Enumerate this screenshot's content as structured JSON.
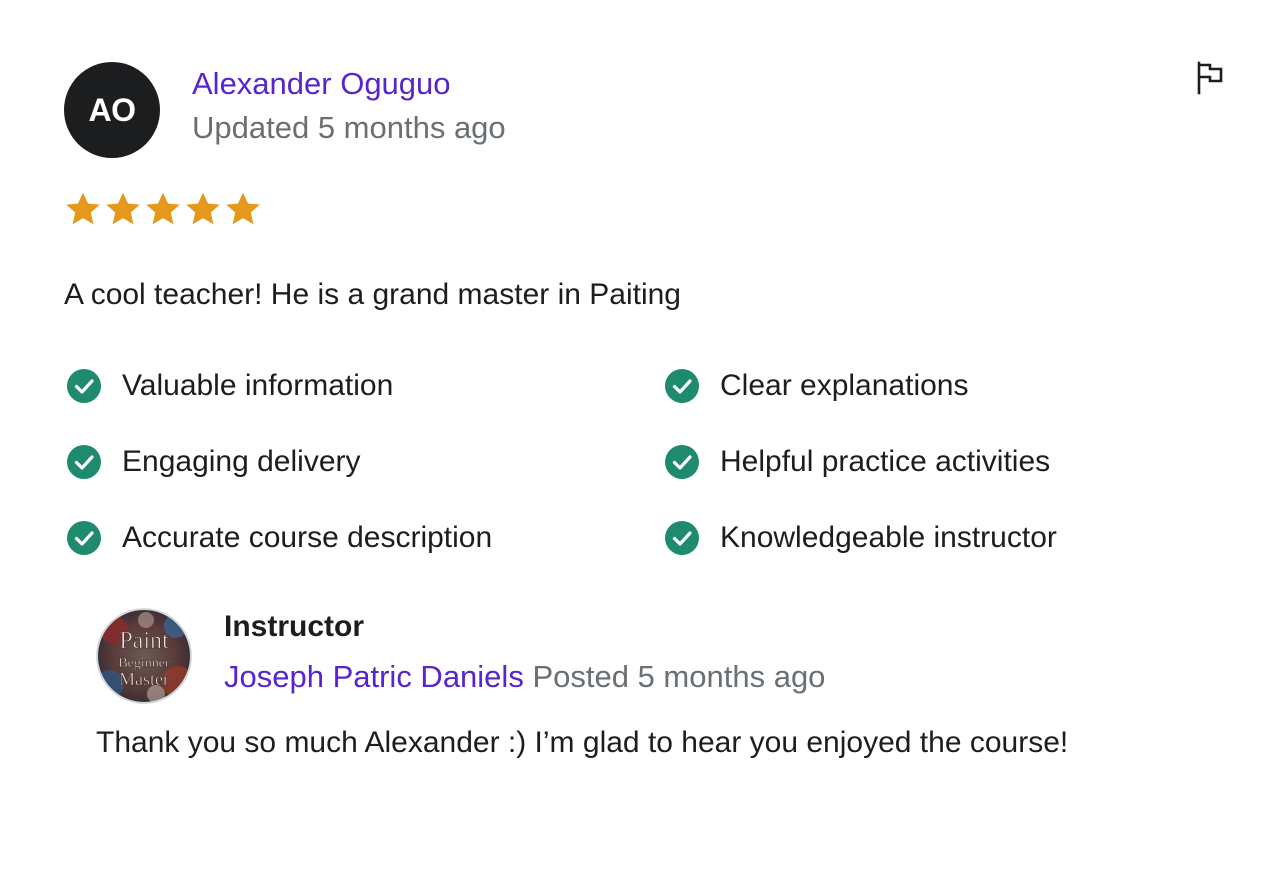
{
  "reviewer": {
    "initials": "AO",
    "name": "Alexander Oguguo",
    "updated": "Updated 5 months ago",
    "rating": 5,
    "review_text": "A cool teacher! He is a grand master in Paiting"
  },
  "feedback_items": [
    "Valuable information",
    "Clear explanations",
    "Engaging delivery",
    "Helpful practice activities",
    "Accurate course description",
    "Knowledgeable instructor"
  ],
  "instructor_response": {
    "role": "Instructor",
    "avatar_text": [
      "Paint",
      "Beginner",
      "Master"
    ],
    "name": "Joseph Patric Daniels",
    "posted": "Posted 5 months ago",
    "reply": "Thank you so much Alexander :) I’m glad to hear you enjoyed the course!"
  },
  "icons": {
    "flag": "flag-icon",
    "star": "star-icon",
    "check": "check-circle-icon"
  },
  "colors": {
    "accent": "#5624d0",
    "star": "#e59819",
    "check": "#1e8a6e",
    "muted": "#6a6f73",
    "text": "#1c1d1f"
  }
}
